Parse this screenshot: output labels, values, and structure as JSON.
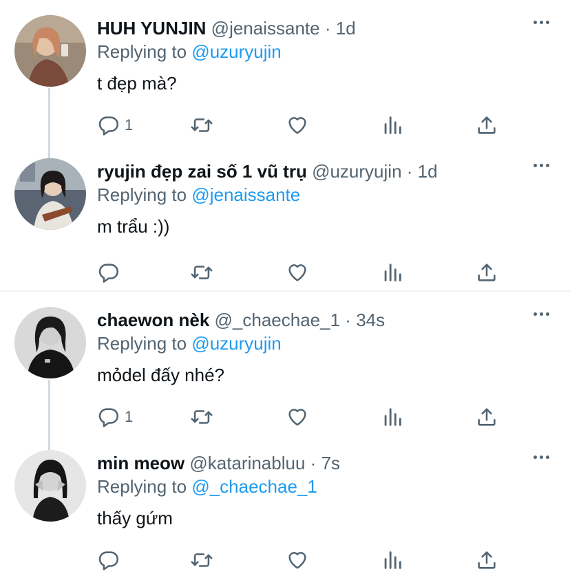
{
  "tweets": [
    {
      "name": "HUH YUNJIN",
      "handle": "@jenaissante",
      "time": "1d",
      "replying_prefix": "Replying to",
      "replying_to": "@uzuryujin",
      "text": "t đẹp mà?",
      "reply_count": "1"
    },
    {
      "name": "ryujin đẹp zai số 1 vũ trụ",
      "handle": "@uzuryujin",
      "time": "1d",
      "replying_prefix": "Replying to",
      "replying_to": "@jenaissante",
      "text": "m trẩu :))",
      "reply_count": ""
    },
    {
      "name": "chaewon nèk",
      "handle": "@_chaechae_1",
      "time": "34s",
      "replying_prefix": "Replying to",
      "replying_to": "@uzuryujin",
      "text": "mỏdel đấy nhé?",
      "reply_count": "1"
    },
    {
      "name": "min meow",
      "handle": "@katarinabluu",
      "time": "7s",
      "replying_prefix": "Replying to",
      "replying_to": "@_chaechae_1",
      "text": "thấy gứm",
      "reply_count": ""
    }
  ],
  "separator": "·",
  "colors": {
    "link": "#1d9bf0",
    "secondary_text": "#536471",
    "thread_line": "#cfd9de",
    "divider": "#eff3f4"
  },
  "icons": [
    "reply-icon",
    "retweet-icon",
    "like-icon",
    "analytics-icon",
    "share-icon",
    "more-icon"
  ]
}
